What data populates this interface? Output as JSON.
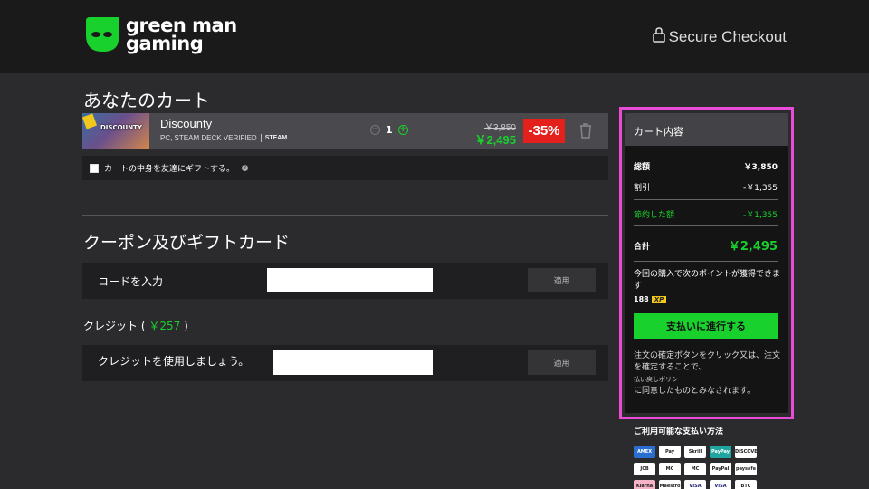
{
  "header": {
    "logo_line1": "green man",
    "logo_line2": "gaming",
    "secure_label": "Secure Checkout"
  },
  "cart": {
    "title": "あなたのカート",
    "item": {
      "name": "Discounty",
      "thumb_title": "DISCOUNTY",
      "platforms": "PC, STEAM DECK VERIFIED",
      "store": "STEAM",
      "quantity": "1",
      "price_old": "￥3,850",
      "price_new": "￥2,495",
      "discount": "-35%"
    },
    "gift_label": "カートの中身を友達にギフトする。",
    "help_icon": "?"
  },
  "coupon": {
    "title": "クーポン及びギフトカード",
    "code_label": "コードを入力",
    "code_value": "",
    "apply_label": "適用"
  },
  "credit": {
    "label": "クレジット (",
    "amount": "￥257",
    "label_end": ")",
    "use_label": "クレジットを使用しましょう。",
    "credit_value": "",
    "apply_label": "適用"
  },
  "summary": {
    "title": "カート内容",
    "total_label": "総額",
    "total_value": "￥3,850",
    "discount_label": "割引",
    "discount_value": "-￥1,355",
    "saved_label": "節約した額",
    "saved_value": "-￥1,355",
    "grand_label": "合計",
    "grand_value": "￥2,495",
    "points_text": "今回の購入で次のポイントが獲得できます",
    "points_value": "188",
    "xp_label": "XP",
    "pay_button": "支払いに進行する",
    "terms_1": "注文の確定ボタンをクリック又は、注文を確定することで、",
    "refund_link": "払い戻しポリシー",
    "terms_2": "に同意したものとみなされます。"
  },
  "payment": {
    "title": "ご利用可能な支払い方法",
    "methods": [
      "AMEX",
      "Pay",
      "Skrill",
      "PayPay",
      "DISCOVER",
      "JCB",
      "MC",
      "MC",
      "PayPal",
      "paysafe",
      "Klarna",
      "Maestro",
      "VISA",
      "VISA",
      "BTC"
    ]
  },
  "colors": {
    "accent_green": "#19d12d",
    "discount_red": "#e3201b",
    "highlight_outline": "#e84bd6"
  }
}
